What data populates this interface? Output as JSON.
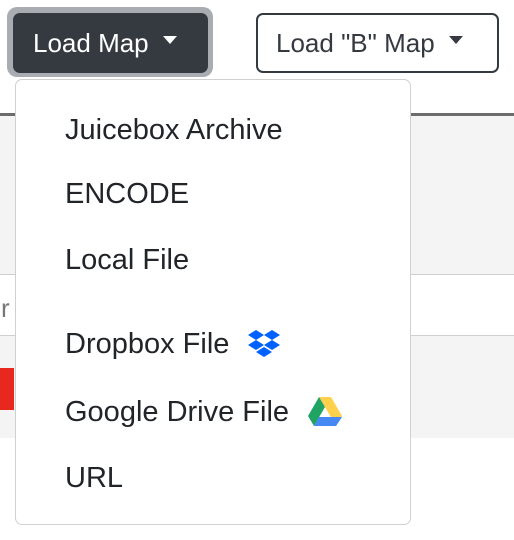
{
  "toolbar": {
    "load_map_label": "Load Map",
    "load_b_map_label": "Load \"B\" Map"
  },
  "dropdown": {
    "items": [
      {
        "label": "Juicebox Archive"
      },
      {
        "label": "ENCODE"
      },
      {
        "label": "Local File"
      },
      {
        "label": "Dropbox File",
        "icon": "dropbox-icon"
      },
      {
        "label": "Google Drive File",
        "icon": "google-drive-icon"
      },
      {
        "label": "URL"
      }
    ]
  },
  "background": {
    "partial_text": "nr"
  },
  "colors": {
    "button_dark": "#343a40",
    "dropbox_blue": "#0061fe",
    "drive_green": "#1fa463",
    "drive_yellow": "#ffd04b",
    "drive_blue": "#4688f4",
    "accent_red": "#e8281e"
  }
}
